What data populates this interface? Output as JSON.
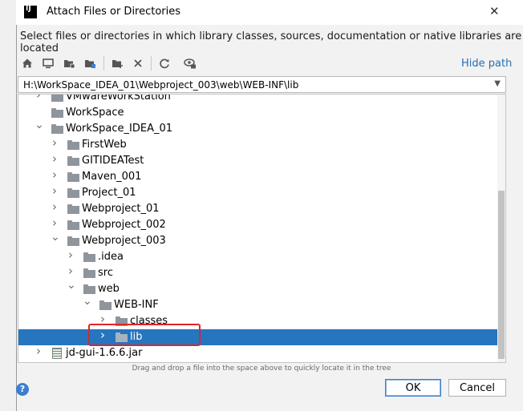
{
  "window": {
    "title": "Attach Files or Directories",
    "close_glyph": "✕",
    "app_icon_label": "IJ"
  },
  "description": "Select files or directories in which library classes, sources, documentation or native libraries are located",
  "toolbar": {
    "icons": [
      "home-icon",
      "desktop-icon",
      "project-icon",
      "module-icon",
      "new-folder-icon",
      "delete-icon",
      "refresh-icon",
      "show-hidden-icon"
    ],
    "hide_path_label": "Hide path"
  },
  "path": {
    "value": "H:\\WorkSpace_IDEA_01\\Webproject_003\\web\\WEB-INF\\lib"
  },
  "tree": {
    "items": [
      {
        "label": "VMwareWorkStation",
        "state": "collapsed",
        "type": "folder"
      },
      {
        "label": "WorkSpace",
        "state": "leaf",
        "type": "folder"
      },
      {
        "label": "WorkSpace_IDEA_01",
        "state": "expanded",
        "type": "folder"
      },
      {
        "label": "FirstWeb",
        "state": "collapsed",
        "type": "folder"
      },
      {
        "label": "GITIDEATest",
        "state": "collapsed",
        "type": "folder"
      },
      {
        "label": "Maven_001",
        "state": "collapsed",
        "type": "folder"
      },
      {
        "label": "Project_01",
        "state": "collapsed",
        "type": "folder"
      },
      {
        "label": "Webproject_01",
        "state": "collapsed",
        "type": "folder"
      },
      {
        "label": "Webproject_002",
        "state": "collapsed",
        "type": "folder"
      },
      {
        "label": "Webproject_003",
        "state": "expanded",
        "type": "folder"
      },
      {
        "label": ".idea",
        "state": "collapsed",
        "type": "folder"
      },
      {
        "label": "src",
        "state": "collapsed",
        "type": "folder"
      },
      {
        "label": "web",
        "state": "expanded",
        "type": "folder"
      },
      {
        "label": "WEB-INF",
        "state": "expanded",
        "type": "folder"
      },
      {
        "label": "classes",
        "state": "collapsed",
        "type": "folder"
      },
      {
        "label": "lib",
        "state": "collapsed",
        "type": "folder",
        "selected": true
      },
      {
        "label": "jd-gui-1.6.6.jar",
        "state": "collapsed",
        "type": "jar"
      }
    ]
  },
  "hint": "Drag and drop a file into the space above to quickly locate it in the tree",
  "buttons": {
    "help_glyph": "?",
    "ok_label": "OK",
    "cancel_label": "Cancel"
  },
  "colors": {
    "selection": "#2675bf",
    "link": "#2470b3",
    "highlight_box": "#e0242a"
  }
}
